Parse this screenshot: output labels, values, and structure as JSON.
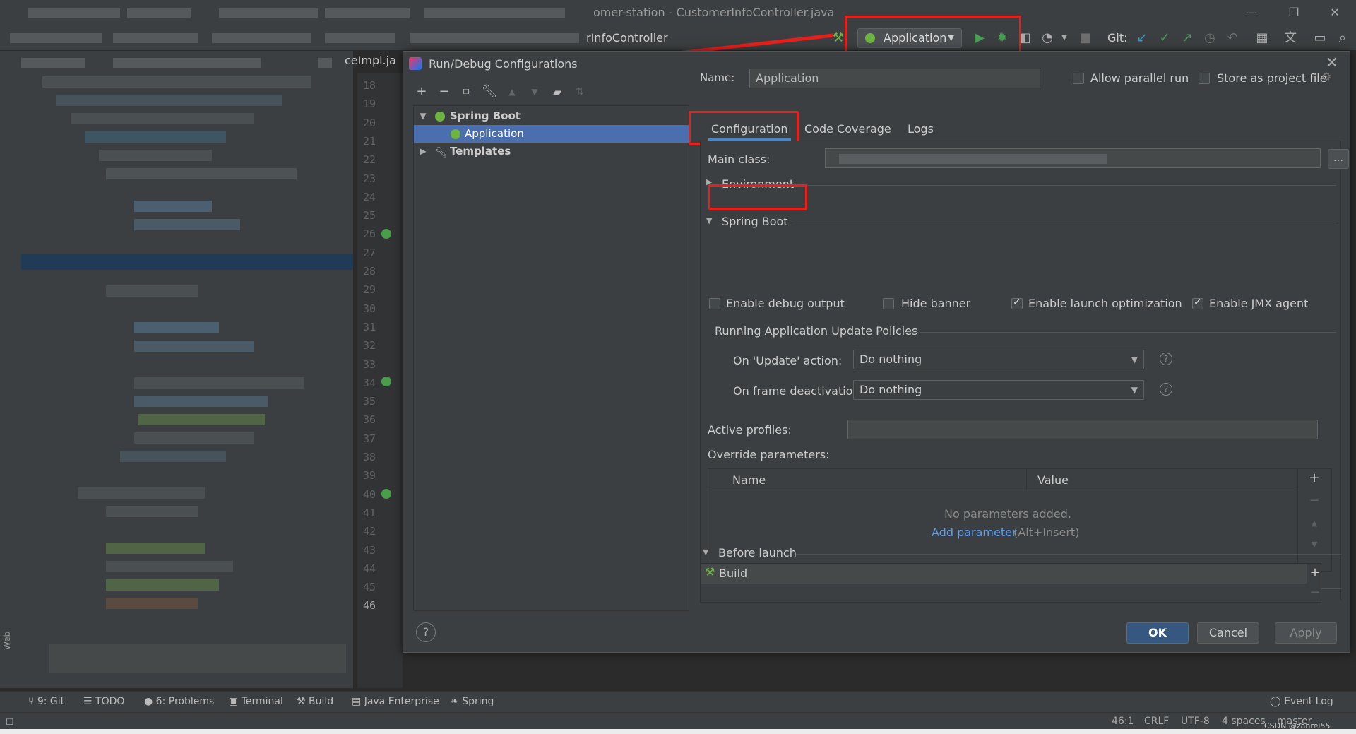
{
  "window": {
    "title": "omer-station - CustomerInfoController.java",
    "minimize": "—",
    "restore": "❐",
    "close": "✕"
  },
  "toolbar": {
    "nav_file": "rInfoController",
    "run_config_label": "Application",
    "git_label": "Git:"
  },
  "editor": {
    "tab_label": "ceImpl.ja",
    "line_numbers": [
      "18",
      "19",
      "20",
      "21",
      "22",
      "23",
      "24",
      "25",
      "26",
      "27",
      "28",
      "29",
      "30",
      "31",
      "32",
      "33",
      "34",
      "35",
      "36",
      "37",
      "38",
      "39",
      "40",
      "41",
      "42",
      "43",
      "44",
      "45",
      "46"
    ],
    "current_line": "46"
  },
  "dialog": {
    "title": "Run/Debug Configurations",
    "close": "✕",
    "tree": {
      "group_label": "Spring Boot",
      "item_label": "Application",
      "templates_label": "Templates"
    },
    "name_label": "Name:",
    "name_value": "Application",
    "allow_parallel_label": "Allow parallel run",
    "store_as_project_label": "Store as project file",
    "tabs": [
      "Configuration",
      "Code Coverage",
      "Logs"
    ],
    "main_class_label": "Main class:",
    "browse_label": "...",
    "environment_label": "Environment",
    "spring_boot_label": "Spring Boot",
    "enable_debug_label": "Enable debug output",
    "hide_banner_label": "Hide banner",
    "launch_opt_label": "Enable launch optimization",
    "jmx_label": "Enable JMX agent",
    "policies_label": "Running Application Update Policies",
    "on_update_label": "On 'Update' action:",
    "on_update_value": "Do nothing",
    "on_frame_label": "On frame deactivation:",
    "on_frame_value": "Do nothing",
    "active_profiles_label": "Active profiles:",
    "override_label": "Override parameters:",
    "table_col_name": "Name",
    "table_col_value": "Value",
    "no_params": "No parameters added.",
    "add_param_link": "Add parameter",
    "add_param_hint": "(Alt+Insert)",
    "before_launch_label": "Before launch",
    "build_label": "Build",
    "ok_label": "OK",
    "cancel_label": "Cancel",
    "apply_label": "Apply",
    "help_label": "?"
  },
  "bottom_bar": {
    "git": "9: Git",
    "todo": "TODO",
    "problems": "6: Problems",
    "terminal": "Terminal",
    "build": "Build",
    "java_enterprise": "Java Enterprise",
    "spring": "Spring",
    "event_log": "Event Log",
    "web": "Web"
  },
  "status_bar": {
    "position": "46:1",
    "line_sep": "CRLF",
    "encoding": "UTF-8",
    "indent": "4 spaces",
    "branch": "master",
    "watermark": "CSDN @zanrei55"
  },
  "colors": {
    "accent": "#4b6eaf",
    "link": "#589df6",
    "annotation": "#e8201c",
    "run_green": "#499c54"
  }
}
